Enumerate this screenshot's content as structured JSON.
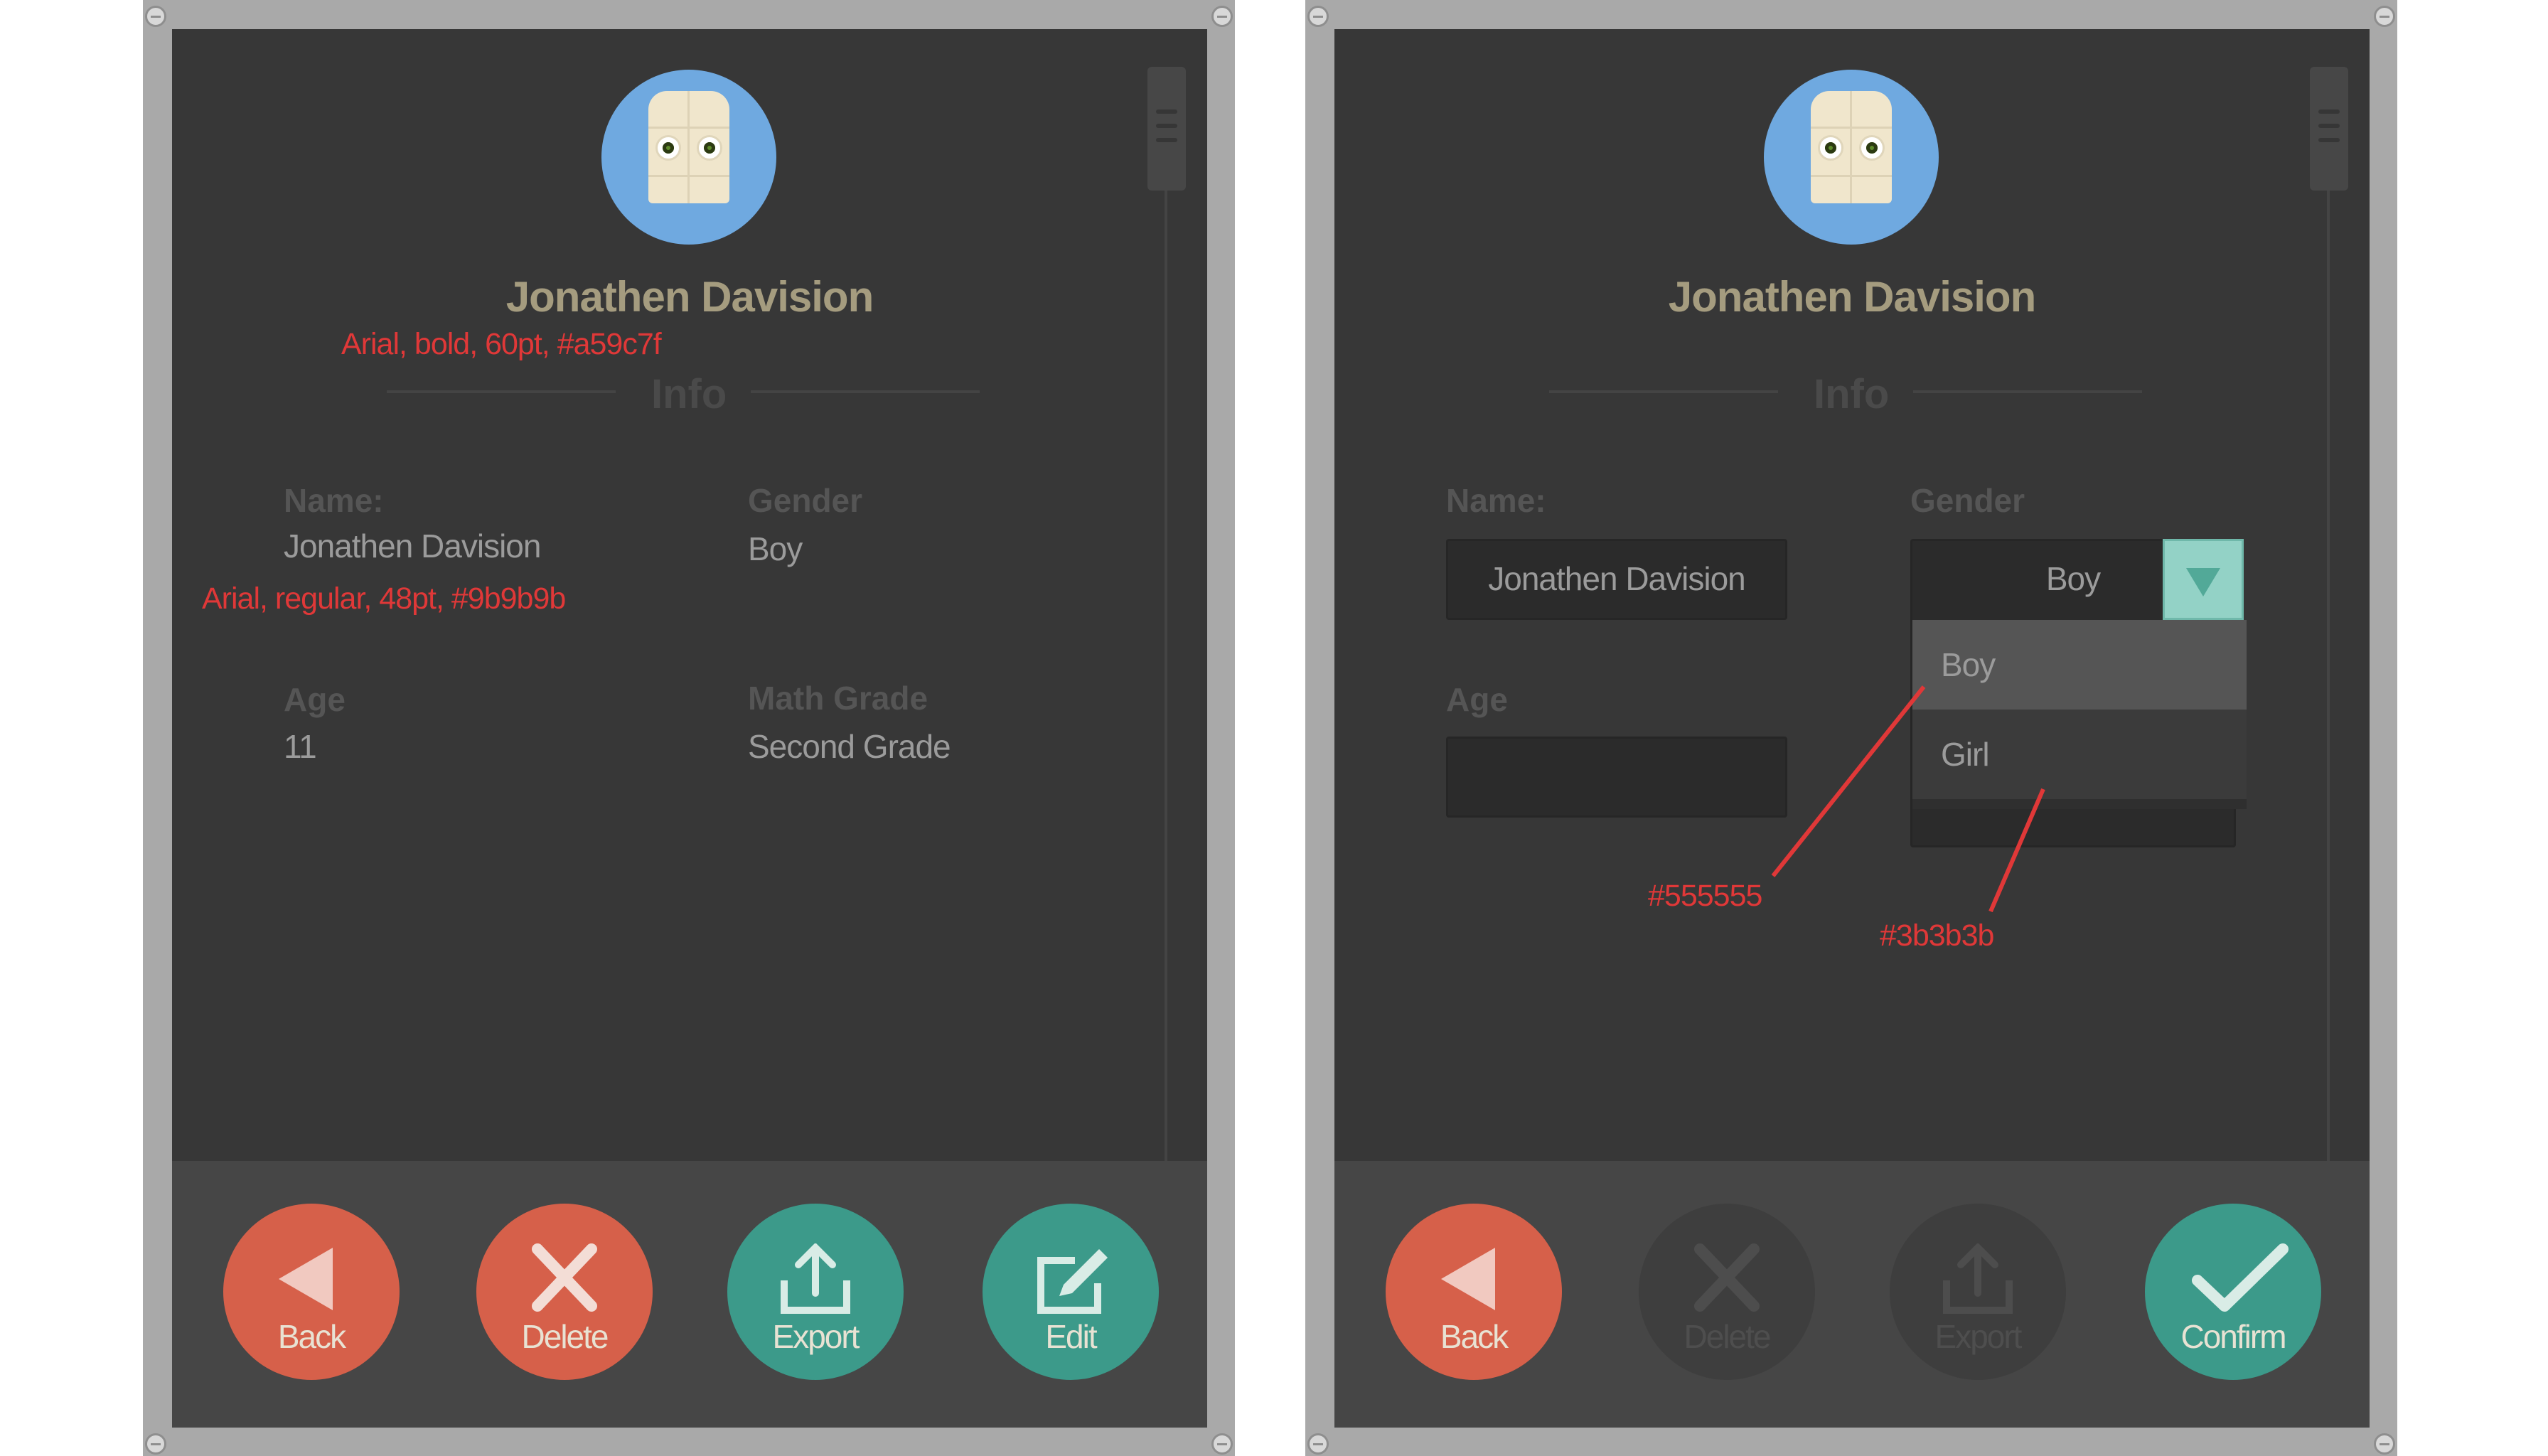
{
  "left_panel": {
    "profile": {
      "name": "Jonathen Davision"
    },
    "section_label": "Info",
    "fields": {
      "name_label": "Name:",
      "name_value": "Jonathen Davision",
      "gender_label": "Gender",
      "gender_value": "Boy",
      "age_label": "Age",
      "age_value": "11",
      "grade_label": "Math Grade",
      "grade_value": "Second Grade"
    },
    "actions": {
      "back": "Back",
      "delete": "Delete",
      "export": "Export",
      "edit": "Edit"
    }
  },
  "right_panel": {
    "profile": {
      "name": "Jonathen Davision"
    },
    "section_label": "Info",
    "form": {
      "name_label": "Name:",
      "name_value": "Jonathen Davision",
      "gender_label": "Gender",
      "gender_value": "Boy",
      "gender_options": [
        "Boy",
        "Girl"
      ],
      "age_label": "Age",
      "age_value": ""
    },
    "actions": {
      "back": "Back",
      "delete": "Delete",
      "export": "Export",
      "confirm": "Confirm"
    }
  },
  "annotations": {
    "title_font": "Arial, bold, 60pt, #a59c7f",
    "value_font": "Arial, regular, 48pt, #9b9b9b",
    "hover_color": "#555555",
    "list_color": "#3b3b3b"
  },
  "colors": {
    "screen_bg": "#373737",
    "bottom_bar": "#464646",
    "title_text": "#a59c7f",
    "value_text": "#9b9b9b",
    "action_red": "#d6604a",
    "action_teal": "#3c9a8a",
    "dropdown_button": "#93d2c6",
    "dropdown_hover": "#555555",
    "dropdown_list": "#3b3b3b",
    "annotation_red": "#e03838"
  }
}
